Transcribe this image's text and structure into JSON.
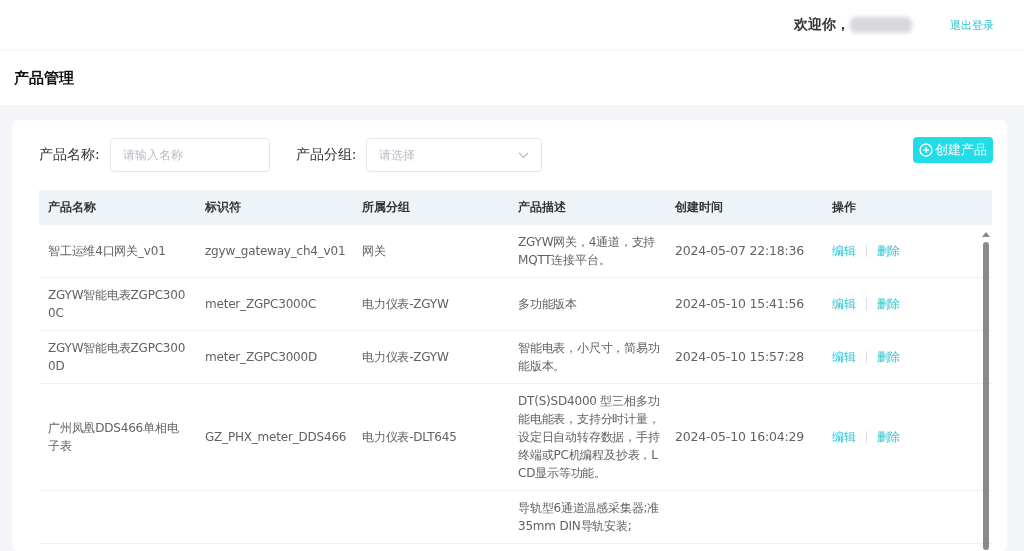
{
  "header": {
    "welcome": "欢迎你，",
    "logout": "退出登录"
  },
  "page_title": "产品管理",
  "filters": [
    {
      "kind": "input",
      "label": "产品名称:",
      "placeholder": "请输入名称"
    },
    {
      "kind": "select",
      "label": "产品分组:",
      "placeholder": "请选择"
    }
  ],
  "create_button": "创建产品",
  "table": {
    "columns": [
      "产品名称",
      "标识符",
      "所属分组",
      "产品描述",
      "创建时间",
      "操作"
    ],
    "rows": [
      {
        "cells": [
          "智工运维4口网关_v01",
          "zgyw_gateway_ch4_v01",
          "网关",
          "ZGYW网关，4通道，支持MQTT连接平台。",
          "2024-05-07 22:18:36"
        ],
        "actions": [
          "编辑",
          "删除"
        ]
      },
      {
        "cells": [
          "ZGYW智能电表ZGPC3000C",
          "meter_ZGPC3000C",
          "电力仪表-ZGYW",
          "多功能版本",
          "2024-05-10 15:41:56"
        ],
        "actions": [
          "编辑",
          "删除"
        ]
      },
      {
        "cells": [
          "ZGYW智能电表ZGPC3000D",
          "meter_ZGPC3000D",
          "电力仪表-ZGYW",
          "智能电表，小尺寸，简易功能版本。",
          "2024-05-10 15:57:28"
        ],
        "actions": [
          "编辑",
          "删除"
        ]
      },
      {
        "cells": [
          "广州凤凰DDS466单相电子表",
          "GZ_PHX_meter_DDS466",
          "电力仪表-DLT645",
          "DT(S)SD4000 型三相多功能电能表，支持分时计量，设定日自动转存数据，手持终端或PC机编程及抄表，LCD显示等功能。",
          "2024-05-10 16:04:29"
        ],
        "actions": [
          "编辑",
          "删除"
        ]
      },
      {
        "cells": [
          "",
          "",
          "",
          "导轨型6通道温感采集器;准35mm DIN导轨安装;",
          ""
        ],
        "actions": []
      }
    ]
  }
}
